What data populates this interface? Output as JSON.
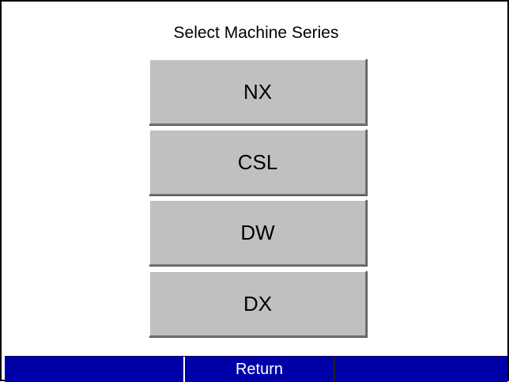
{
  "screen": {
    "title": "Select Machine Series"
  },
  "series_buttons": [
    {
      "label": "NX"
    },
    {
      "label": "CSL"
    },
    {
      "label": "DW"
    },
    {
      "label": "DX"
    }
  ],
  "footer": {
    "return_label": "Return"
  },
  "colors": {
    "button_face": "#c0c0c0",
    "footer_bar": "#0000a8",
    "footer_text": "#ffffff",
    "title_text": "#000000"
  }
}
